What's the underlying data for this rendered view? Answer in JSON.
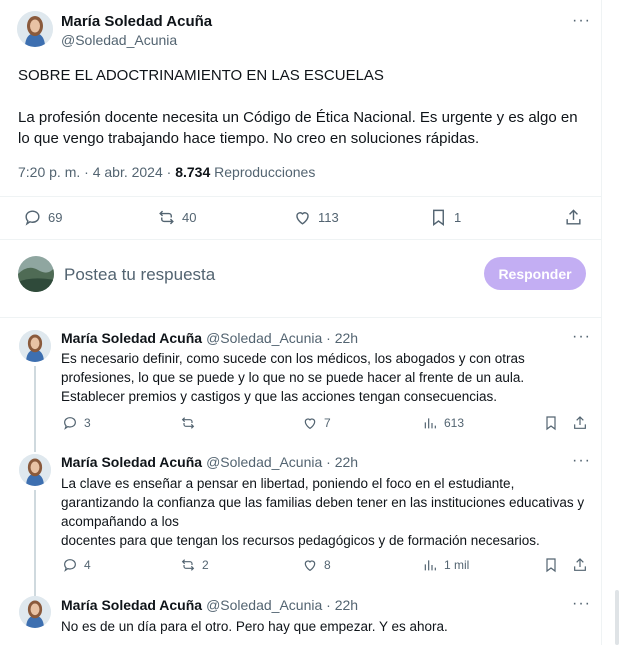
{
  "tweet": {
    "author_name": "María Soledad Acuña",
    "author_handle": "@Soledad_Acunia",
    "more": "···",
    "text_line1": "SOBRE EL ADOCTRINAMIENTO EN LAS ESCUELAS",
    "text_para": "La profesión docente necesita un Código de Ética Nacional. Es urgente y es algo en lo que vengo trabajando hace tiempo. No creo en soluciones rápidas.",
    "time": "7:20 p. m. · 4 abr. 2024 ·",
    "views_count": "8.734",
    "views_label": "Reproducciones",
    "replies": "69",
    "reposts": "40",
    "likes": "113",
    "bookmarks": "1"
  },
  "reply_composer": {
    "placeholder": "Postea tu respuesta",
    "button_label": "Responder"
  },
  "replies": [
    {
      "name": "María Soledad Acuña",
      "handle": "@Soledad_Acunia · 22h",
      "more": "···",
      "lines": [
        "Es necesario definir, como sucede con los médicos, los abogados y con otras",
        "profesiones, lo que se puede y lo que no se puede hacer al frente de un aula.",
        "Establecer premios y castigos y que las acciones tengan consecuencias."
      ],
      "replies": "3",
      "reposts": "",
      "likes": "7",
      "views": "613"
    },
    {
      "name": "María Soledad Acuña",
      "handle": "@Soledad_Acunia · 22h",
      "more": "···",
      "lines": [
        "La clave es enseñar a pensar en libertad, poniendo el foco en el estudiante,",
        "garantizando la confianza que las familias deben tener en las instituciones educativas y",
        "acompañando a los",
        "docentes para que tengan los recursos pedagógicos y de formación necesarios."
      ],
      "replies": "4",
      "reposts": "2",
      "likes": "8",
      "views": "1 mil"
    },
    {
      "name": "María Soledad Acuña",
      "handle": "@Soledad_Acunia · 22h",
      "more": "···",
      "lines": [
        "No es de un día para el otro. Pero hay que empezar. Y es ahora."
      ]
    }
  ],
  "colors": {
    "text": "#0f1419",
    "muted": "#536471",
    "button": "#c3aef3",
    "divider": "#eff3f4"
  }
}
